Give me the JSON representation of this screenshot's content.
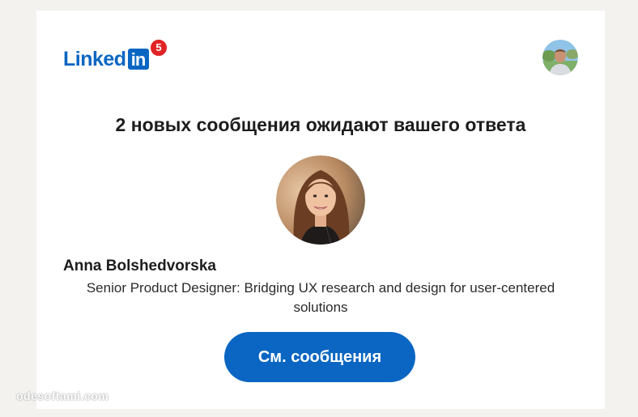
{
  "header": {
    "logo_text": "Linked",
    "logo_box_text": "in",
    "notification_count": "5",
    "user_avatar_icon": "user-photo-icon"
  },
  "message": {
    "headline": "2 новых сообщения ожидают вашего ответа",
    "sender": {
      "name": "Anna Bolshedvorska",
      "headline": "Senior Product Designer: Bridging UX research and design for user-centered solutions",
      "avatar_icon": "profile-photo-icon"
    },
    "cta_label": "См. сообщения"
  },
  "watermark": "odesoftami.com",
  "colors": {
    "brand": "#0a66c2",
    "badge": "#e02424",
    "background": "#f3f2ef",
    "card": "#ffffff"
  }
}
